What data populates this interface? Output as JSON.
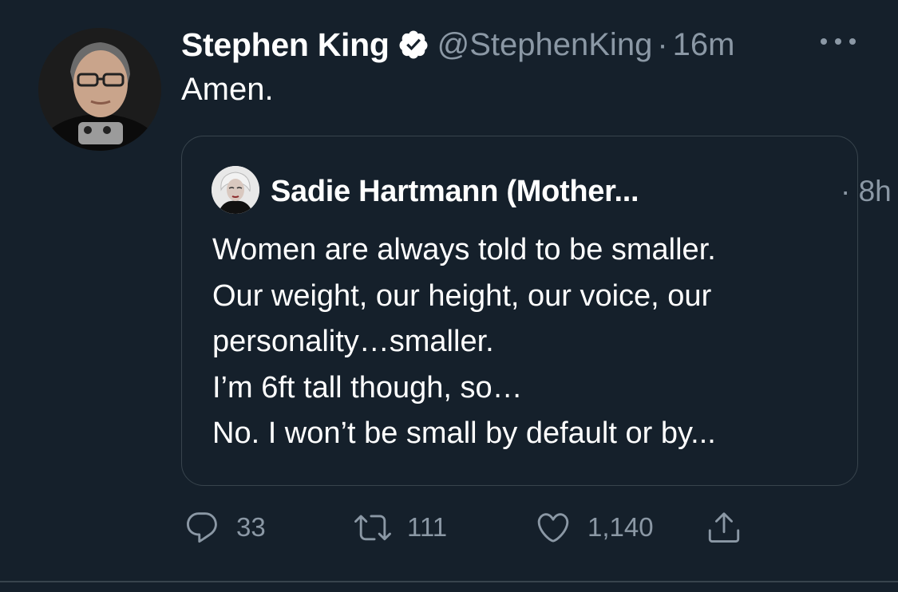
{
  "tweet": {
    "author_name": "Stephen King",
    "handle": "@StephenKing",
    "separator": "·",
    "timestamp": "16m",
    "text": "Amen.",
    "verified_icon": "verified-badge-icon",
    "more_icon": "more-options-icon"
  },
  "quote": {
    "author_name": "Sadie Hartmann (Mother...",
    "timestamp": "· 8h",
    "lines": [
      "Women are always told to be smaller.",
      "Our weight, our height, our voice, our",
      "personality…smaller.",
      "I’m 6ft tall though, so…",
      "No. I won’t be small by default or by..."
    ]
  },
  "actions": {
    "reply": {
      "icon": "reply-icon",
      "count": "33"
    },
    "retweet": {
      "icon": "retweet-icon",
      "count": "111"
    },
    "like": {
      "icon": "heart-icon",
      "count": "1,140"
    },
    "share": {
      "icon": "share-icon"
    }
  },
  "colors": {
    "background": "#15202b",
    "secondary_text": "#8b98a5",
    "border": "#38444d",
    "primary_text": "#ffffff"
  }
}
